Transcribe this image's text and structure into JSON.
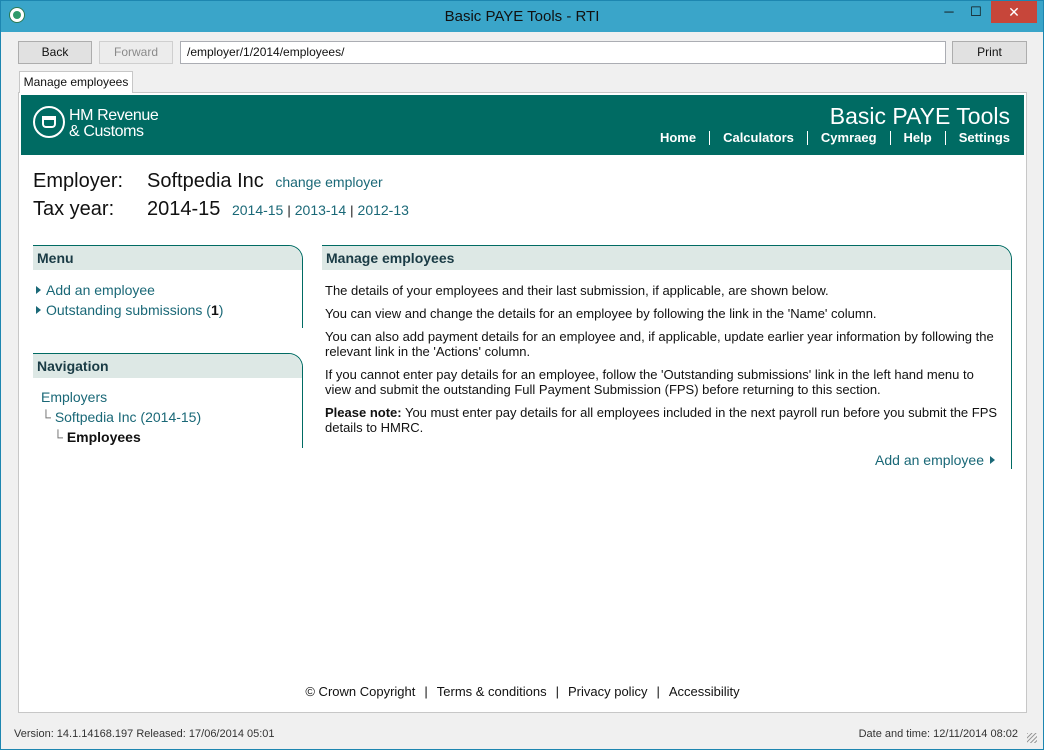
{
  "window": {
    "title": "Basic PAYE Tools - RTI",
    "min": "─",
    "max": "☐",
    "close": "✕"
  },
  "toolbar": {
    "back": "Back",
    "forward": "Forward",
    "url": "/employer/1/2014/employees/",
    "print": "Print"
  },
  "tab": {
    "label": "Manage employees"
  },
  "header": {
    "logo_line1": "HM Revenue",
    "logo_line2": "& Customs",
    "brand": "Basic PAYE Tools",
    "nav": [
      "Home",
      "Calculators",
      "Cymraeg",
      "Help",
      "Settings"
    ]
  },
  "employer": {
    "label": "Employer:",
    "name": "Softpedia Inc",
    "change_link": "change employer",
    "tax_year_label": "Tax year:",
    "tax_year": "2014-15",
    "years": [
      "2014-15",
      "2013-14",
      "2012-13"
    ],
    "year_sep": "|"
  },
  "menu": {
    "title": "Menu",
    "add_employee": "Add an employee",
    "outstanding_label": "Outstanding submissions (",
    "outstanding_count": "1",
    "outstanding_close": ")"
  },
  "navigation": {
    "title": "Navigation",
    "employers": "Employers",
    "employer_item": "Softpedia Inc (2014-15)",
    "current": "Employees",
    "tree_glyph": "└"
  },
  "main": {
    "title": "Manage employees",
    "p1": "The details of your employees and their last submission, if applicable, are shown below.",
    "p2": "You can view and change the details for an employee by following the link in the 'Name' column.",
    "p3": "You can also add payment details for an employee and, if applicable, update earlier year information by following the relevant link in the 'Actions' column.",
    "p4": "If you cannot enter pay details for an employee, follow the 'Outstanding submissions' link in the left hand menu to view and submit the outstanding Full Payment Submission (FPS) before returning to this section.",
    "note_label": "Please note:",
    "note_text": " You must enter pay details for all employees included in the next payroll run before you submit the FPS details to HMRC.",
    "add_link": "Add an employee"
  },
  "footer": {
    "copyright": "© Crown Copyright",
    "sep": "|",
    "links": [
      "Terms & conditions",
      "Privacy policy",
      "Accessibility"
    ]
  },
  "status": {
    "version": "Version: 14.1.14168.197 Released: 17/06/2014 05:01",
    "datetime": "Date and time: 12/11/2014 08:02"
  }
}
